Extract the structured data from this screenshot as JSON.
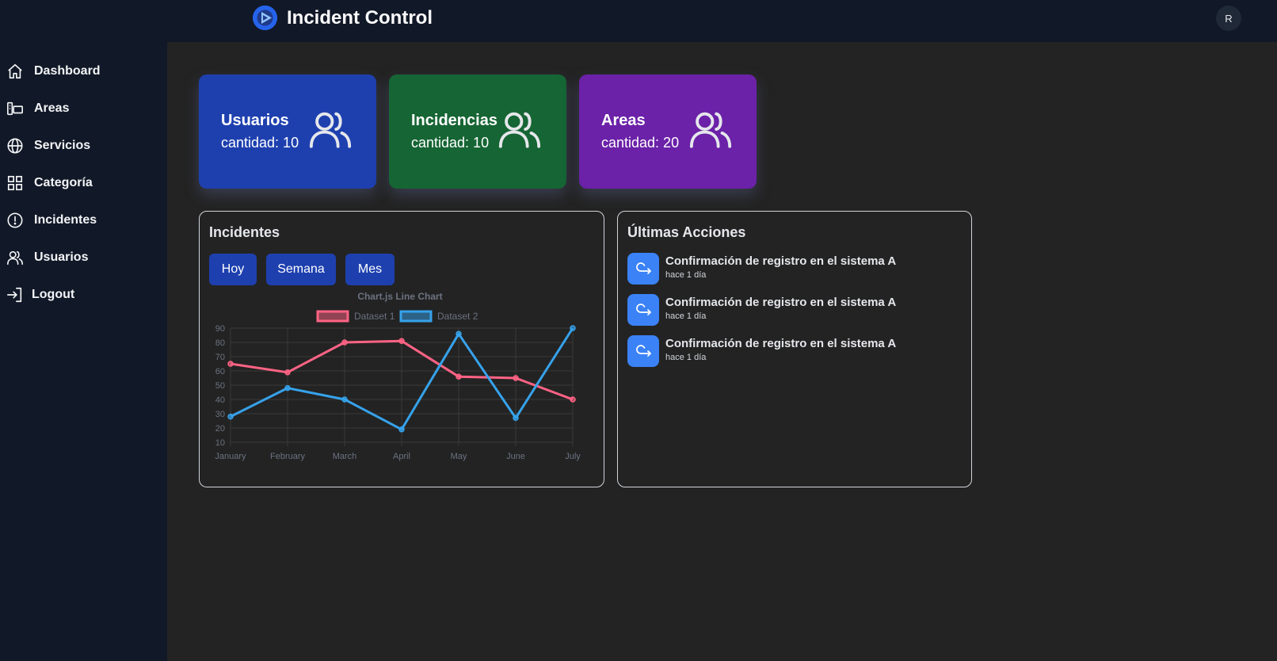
{
  "app": {
    "title": "Incident Control",
    "avatar_initial": "R"
  },
  "sidebar": {
    "items": [
      {
        "label": "Dashboard",
        "icon": "home-icon"
      },
      {
        "label": "Areas",
        "icon": "areas-icon"
      },
      {
        "label": "Servicios",
        "icon": "globe-icon"
      },
      {
        "label": "Categoría",
        "icon": "grid-icon"
      },
      {
        "label": "Incidentes",
        "icon": "alert-circle-icon"
      },
      {
        "label": "Usuarios",
        "icon": "users-icon"
      },
      {
        "label": "Logout",
        "icon": "logout-icon"
      }
    ]
  },
  "cards": [
    {
      "title": "Usuarios",
      "count": "cantidad: 10",
      "color": "#1e40af",
      "icon": "users-icon"
    },
    {
      "title": "Incidencias",
      "count": "cantidad: 10",
      "color": "#166534",
      "icon": "users-icon"
    },
    {
      "title": "Areas",
      "count": "cantidad: 20",
      "color": "#6b21a8",
      "icon": "users-icon"
    }
  ],
  "incidents_panel": {
    "title": "Incidentes",
    "range_buttons": [
      "Hoy",
      "Semana",
      "Mes"
    ]
  },
  "actions_panel": {
    "title": "Últimas Acciones",
    "items": [
      {
        "title": "Confirmación de registro en el sistema A",
        "time": "hace 1 día",
        "icon": "redo-icon"
      },
      {
        "title": "Confirmación de registro en el sistema A",
        "time": "hace 1 día",
        "icon": "redo-icon"
      },
      {
        "title": "Confirmación de registro en el sistema A",
        "time": "hace 1 día",
        "icon": "redo-icon"
      }
    ]
  },
  "chart_data": {
    "type": "line",
    "title": "Chart.js Line Chart",
    "x": [
      "January",
      "February",
      "March",
      "April",
      "May",
      "June",
      "July"
    ],
    "series": [
      {
        "name": "Dataset 1",
        "values": [
          65,
          59,
          80,
          81,
          56,
          55,
          40
        ],
        "color": "#ff6384"
      },
      {
        "name": "Dataset 2",
        "values": [
          28,
          48,
          40,
          19,
          86,
          27,
          90
        ],
        "color": "#36a2eb"
      }
    ],
    "ylim": [
      10,
      90
    ],
    "yticks": [
      90,
      80,
      70,
      60,
      50,
      40,
      30,
      20,
      10
    ],
    "grid": true,
    "legend": "top"
  }
}
